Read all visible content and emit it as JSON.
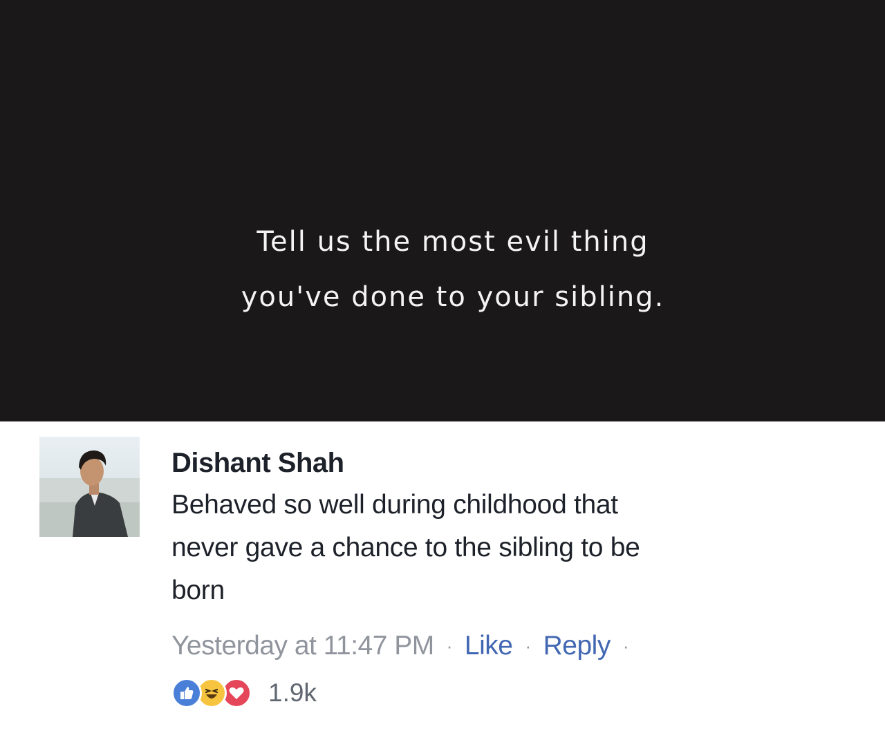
{
  "post": {
    "text_line1": "Tell us the most evil thing",
    "text_line2": "you've done to your sibling.",
    "background": "#1b1819",
    "text_color": "#f4f4f4"
  },
  "comment": {
    "author": "Dishant Shah",
    "text_line1": "Behaved so well during childhood that",
    "text_line2": "never gave a chance to the sibling to be",
    "text_line3": "born",
    "timestamp": "Yesterday at 11:47 PM",
    "separator": "·",
    "like_label": "Like",
    "reply_label": "Reply",
    "reactions": {
      "icons": [
        "like-icon",
        "haha-icon",
        "love-icon"
      ],
      "count": "1.9k"
    }
  },
  "colors": {
    "link": "#4267b2",
    "meta": "#90949c",
    "text": "#1d2129",
    "like": "#4a7fd8",
    "haha": "#f7c43f",
    "love": "#e54659"
  }
}
